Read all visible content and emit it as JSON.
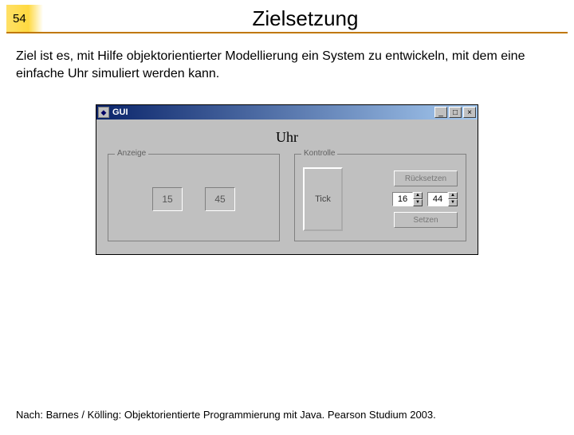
{
  "header": {
    "slide_number": "54",
    "title": "Zielsetzung"
  },
  "body_text": "Ziel ist es, mit Hilfe objektorientierter Modellierung ein System zu entwickeln, mit dem eine einfache Uhr simuliert werden kann.",
  "gui": {
    "window_title": "GUI",
    "min_glyph": "_",
    "max_glyph": "□",
    "close_glyph": "×",
    "main_label": "Uhr",
    "anzeige": {
      "legend": "Anzeige",
      "hours": "15",
      "minutes": "45"
    },
    "kontrolle": {
      "legend": "Kontrolle",
      "tick_label": "Tick",
      "reset_label": "Rücksetzen",
      "set_label": "Setzen",
      "spin_hour": "16",
      "spin_min": "44"
    }
  },
  "footer": "Nach: Barnes / Kölling: Objektorientierte Programmierung mit Java. Pearson Studium 2003."
}
